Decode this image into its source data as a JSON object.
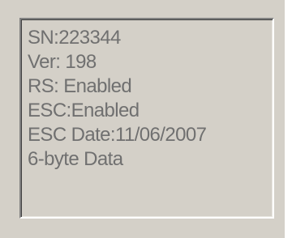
{
  "info_box": {
    "lines": [
      "SN:223344",
      "Ver: 198",
      "RS: Enabled",
      "ESC:Enabled",
      "ESC Date:11/06/2007",
      "6-byte Data"
    ]
  },
  "colors": {
    "background": "#d4d0c8",
    "text": "#707070"
  }
}
